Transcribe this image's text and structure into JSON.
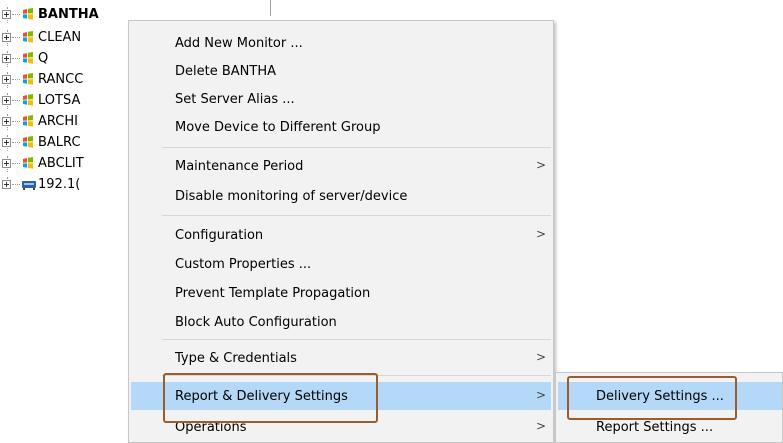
{
  "tree": {
    "nodes": [
      {
        "label": "BANTHA",
        "bold": true,
        "icon": "windows-server-icon"
      },
      {
        "label": "CLEAN",
        "bold": false,
        "icon": "windows-server-icon"
      },
      {
        "label": "Q",
        "bold": false,
        "icon": "windows-server-icon"
      },
      {
        "label": "RANCC",
        "bold": false,
        "icon": "windows-server-icon"
      },
      {
        "label": "LOTSA",
        "bold": false,
        "icon": "windows-server-icon"
      },
      {
        "label": "ARCHI",
        "bold": false,
        "icon": "windows-server-icon"
      },
      {
        "label": "BALRC",
        "bold": false,
        "icon": "windows-server-icon"
      },
      {
        "label": "ABCLIT",
        "bold": false,
        "icon": "windows-server-icon"
      },
      {
        "label": "192.1(",
        "bold": false,
        "icon": "network-device-icon"
      }
    ]
  },
  "context_menu": {
    "items": [
      {
        "label": "Add New Monitor ...",
        "submenu": false
      },
      {
        "label": "Delete BANTHA",
        "submenu": false
      },
      {
        "label": "Set Server Alias ...",
        "submenu": false
      },
      {
        "label": "Move Device to Different Group",
        "submenu": false
      },
      {
        "label": "Maintenance Period",
        "submenu": true
      },
      {
        "label": "Disable monitoring of server/device",
        "submenu": false
      },
      {
        "label": "Configuration",
        "submenu": true
      },
      {
        "label": "Custom Properties ...",
        "submenu": false
      },
      {
        "label": "Prevent Template Propagation",
        "submenu": false
      },
      {
        "label": "Block Auto Configuration",
        "submenu": false
      },
      {
        "label": "Type & Credentials",
        "submenu": true
      },
      {
        "label": "Report & Delivery Settings",
        "submenu": true,
        "highlighted": true
      },
      {
        "label": "Operations",
        "submenu": true
      }
    ],
    "arrow_glyph": ">"
  },
  "submenu": {
    "items": [
      {
        "label": "Delivery Settings ...",
        "highlighted": true
      },
      {
        "label": "Report Settings ..."
      }
    ]
  },
  "colors": {
    "highlight": "#b4d8f8",
    "menu_bg": "#f2f2f2",
    "callout_border": "#9b5c2e"
  }
}
